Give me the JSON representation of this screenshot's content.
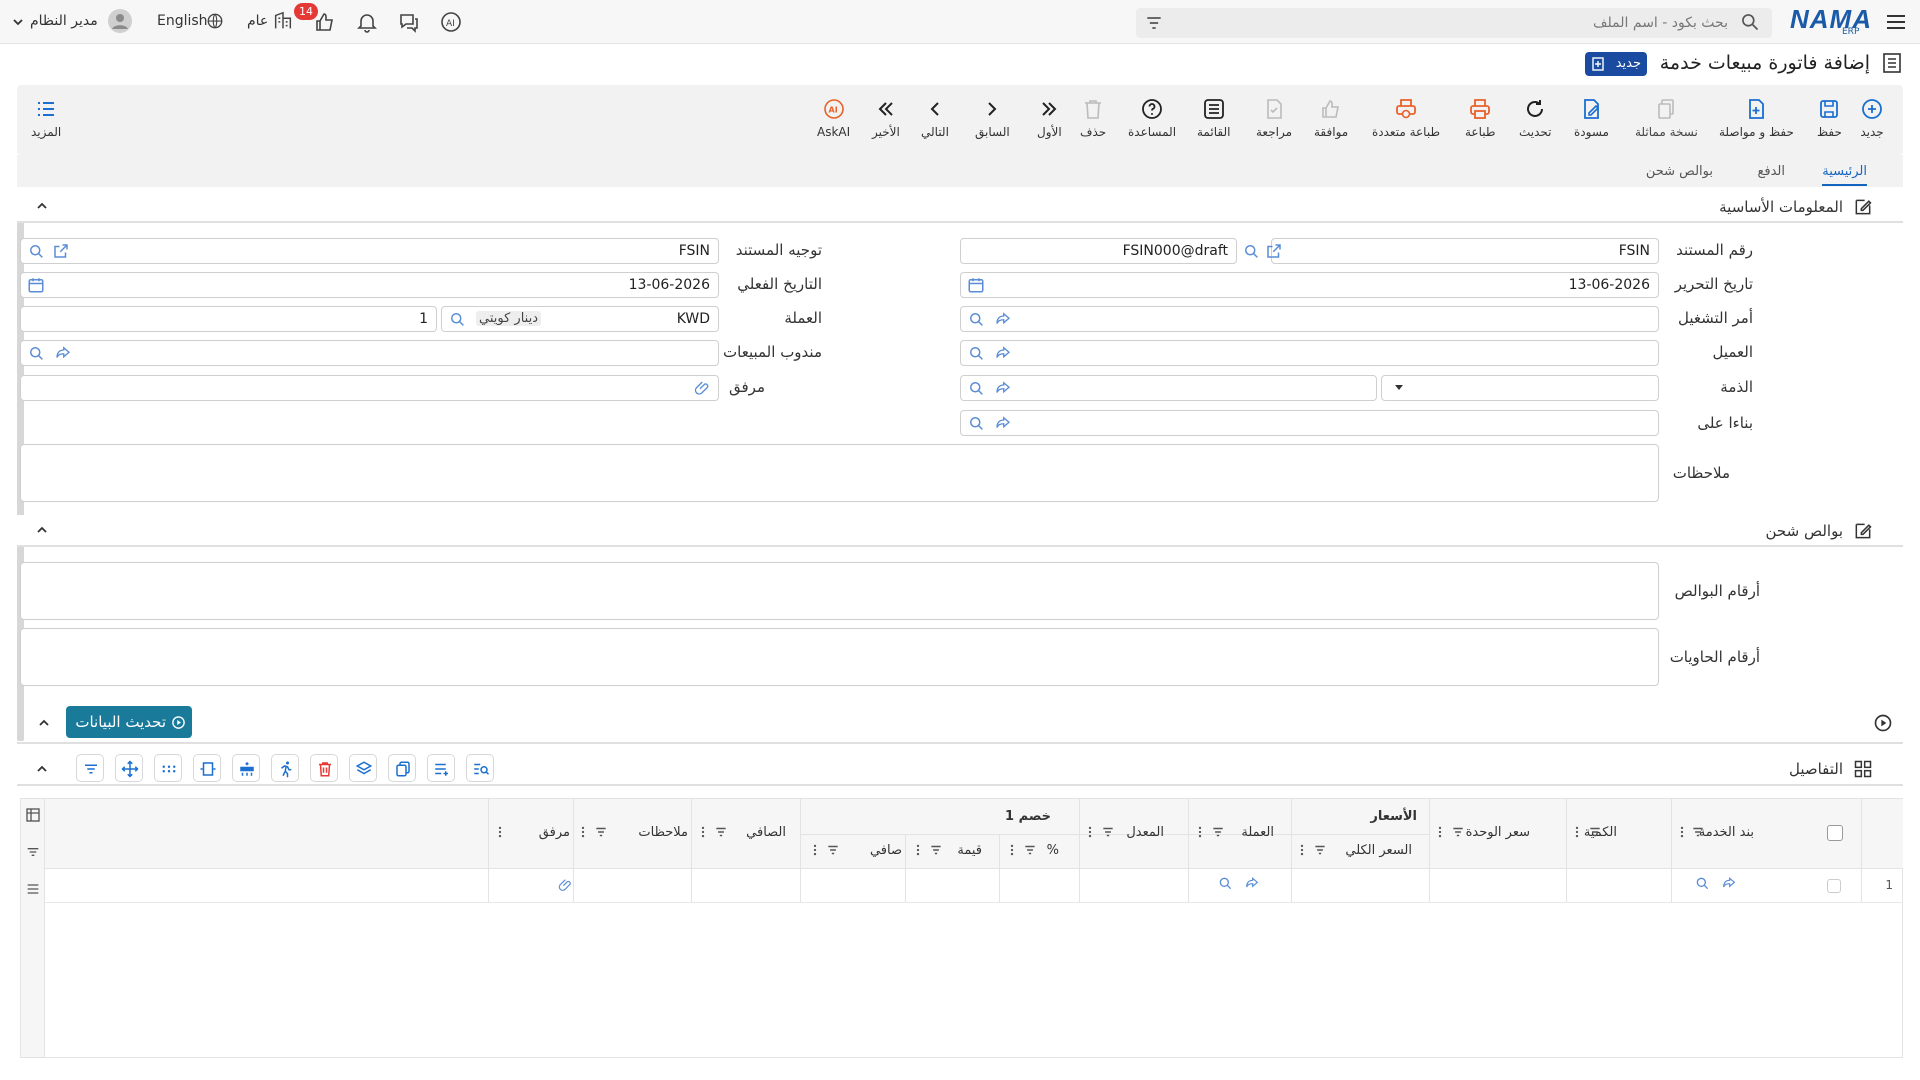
{
  "topbar": {
    "logo": "NAMA",
    "logo_sub": "ERP",
    "search_placeholder": "بحث بكود - اسم الملف",
    "user_name": "مدير النظام",
    "language": "English",
    "scope": "عام",
    "notification_count": "14"
  },
  "header": {
    "title": "إضافة فاتورة مبيعات خدمة",
    "status_badge": "جديد"
  },
  "toolbar": {
    "buttons": [
      "جديد",
      "حفظ",
      "حفظ و مواصلة",
      "نسخة مماثلة",
      "مسودة",
      "تحديث",
      "طباعة",
      "طباعة متعددة",
      "موافقة",
      "مراجعة",
      "القائمة",
      "المساعدة",
      "حذف",
      "الأول",
      "السابق",
      "التالي",
      "الأخير",
      "AskAI"
    ],
    "more": "المزيد"
  },
  "tabs": [
    "الرئيسية",
    "الدفع",
    "بوالص شحن"
  ],
  "sections": {
    "basic": "المعلومات الأساسية",
    "shipping": "بوالص شحن",
    "details": "التفاصيل"
  },
  "form": {
    "doc_number_label": "رقم المستند",
    "doc_number_code": "FSIN",
    "doc_number_value": "FSIN000@draft",
    "doc_direction_label": "توجيه المستند",
    "doc_direction_value": "FSIN",
    "edit_date_label": "تاريخ التحرير",
    "edit_date_value": "13-06-2026",
    "actual_date_label": "التاريخ الفعلي",
    "actual_date_value": "13-06-2026",
    "work_order_label": "أمر التشغيل",
    "currency_label": "العملة",
    "currency_code": "KWD",
    "currency_name": "دينار كويتي",
    "currency_rate": "1",
    "customer_label": "العميل",
    "sales_rep_label": "مندوب المبيعات",
    "account_label": "الذمة",
    "attachment_label": "مرفق",
    "based_on_label": "بناءا على",
    "notes_label": "ملاحظات",
    "policy_numbers_label": "أرقام البوالص",
    "container_numbers_label": "أرقام الحاويات"
  },
  "update_button": "تحديث البيانات",
  "grid": {
    "group_prices": "الأسعار",
    "group_discount": "خصم 1",
    "columns": [
      "بند الخدمة",
      "الكمية",
      "سعر الوحدة",
      "السعر الكلي",
      "العملة",
      "المعدل",
      "%",
      "قيمة",
      "صافي",
      "الصافي",
      "ملاحظات",
      "مرفق"
    ],
    "row_number": "1"
  }
}
